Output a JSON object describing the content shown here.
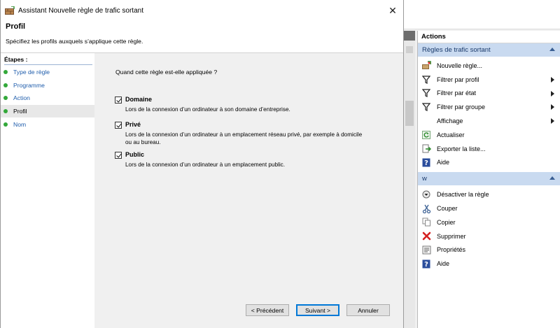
{
  "dialog": {
    "title": "Assistant Nouvelle règle de trafic sortant",
    "close_glyph": "✕",
    "header_title": "Profil",
    "header_subtitle": "Spécifiez les profils auxquels s’applique cette règle."
  },
  "steps": {
    "title": "Étapes :",
    "items": [
      "Type de règle",
      "Programme",
      "Action",
      "Profil",
      "Nom"
    ],
    "current": "Profil"
  },
  "content": {
    "question": "Quand cette règle est-elle appliquée ?",
    "options": [
      {
        "label": "Domaine",
        "checked": true,
        "description": "Lors de la connexion d’un ordinateur à son domaine d’entreprise."
      },
      {
        "label": "Privé",
        "checked": true,
        "description": "Lors de la connexion d’un ordinateur à un emplacement réseau privé, par exemple à domicile ou au bureau."
      },
      {
        "label": "Public",
        "checked": true,
        "description": "Lors de la connexion d’un ordinateur à un emplacement public."
      }
    ]
  },
  "buttons": {
    "previous": "< Précédent",
    "next": "Suivant >",
    "cancel": "Annuler"
  },
  "actions": {
    "title": "Actions",
    "section1": {
      "header": "Règles de trafic sortant",
      "items": [
        {
          "label": "Nouvelle règle...",
          "icon": "new-rule-icon"
        },
        {
          "label": "Filtrer par profil",
          "icon": "filter-icon",
          "submenu": true
        },
        {
          "label": "Filtrer par état",
          "icon": "filter-icon",
          "submenu": true
        },
        {
          "label": "Filtrer par groupe",
          "icon": "filter-icon",
          "submenu": true
        },
        {
          "label": "Affichage",
          "icon": "",
          "submenu": true
        },
        {
          "label": "Actualiser",
          "icon": "refresh-icon"
        },
        {
          "label": "Exporter la liste...",
          "icon": "export-icon"
        },
        {
          "label": "Aide",
          "icon": "help-icon"
        }
      ]
    },
    "section2": {
      "header": "w",
      "items": [
        {
          "label": "Désactiver la règle",
          "icon": "disable-icon"
        },
        {
          "label": "Couper",
          "icon": "cut-icon"
        },
        {
          "label": "Copier",
          "icon": "copy-icon"
        },
        {
          "label": "Supprimer",
          "icon": "delete-icon"
        },
        {
          "label": "Propriétés",
          "icon": "properties-icon"
        },
        {
          "label": "Aide",
          "icon": "help-icon"
        }
      ]
    }
  },
  "colors": {
    "accent": "#0078d7",
    "step_link": "#1f5dac",
    "step_dot": "#33a83a",
    "section_header": "#c9daf0"
  }
}
